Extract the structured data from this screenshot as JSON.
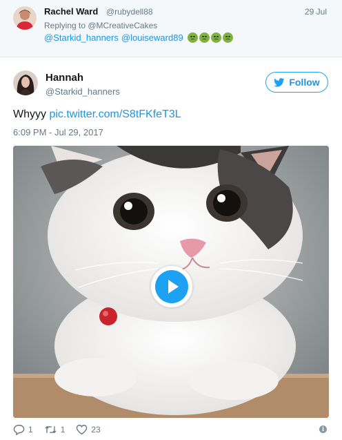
{
  "reply": {
    "name": "Rachel Ward",
    "handle": "@rubydell88",
    "date": "29 Jul",
    "context": "Replying to @MCreativeCakes",
    "mentions": [
      "@Starkid_hanners",
      "@louiseward89"
    ],
    "emoji_count": 4
  },
  "tweet": {
    "author_name": "Hannah",
    "author_handle": "@Starkid_hanners",
    "follow_label": "Follow",
    "text": "Whyyy",
    "link": "pic.twitter.com/S8tFKfeT3L",
    "timestamp": "6:09 PM - Jul 29, 2017"
  },
  "actions": {
    "replies": "1",
    "retweets": "1",
    "likes": "23"
  },
  "colors": {
    "accent": "#1da1f2",
    "link": "#1b95e0",
    "muted": "#657786",
    "reply_background": "#f5f8fa"
  },
  "icons": [
    "twitter-bird-icon",
    "play-icon",
    "reply-icon",
    "retweet-icon",
    "heart-icon",
    "info-icon",
    "sick-face-emoji"
  ]
}
